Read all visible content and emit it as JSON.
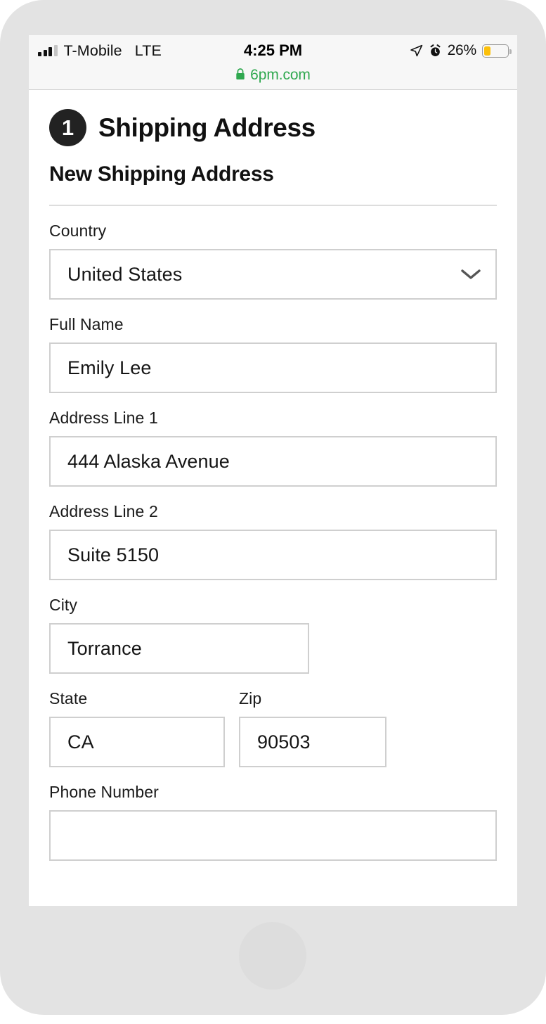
{
  "status_bar": {
    "carrier": "T-Mobile",
    "network": "LTE",
    "time": "4:25 PM",
    "battery_percent": "26%",
    "signal_icon": "signal-bars-icon",
    "location_icon": "location-arrow-icon",
    "alarm_icon": "alarm-clock-icon",
    "battery_icon": "battery-icon",
    "battery_fill_color": "#fcc00a"
  },
  "browser": {
    "lock_icon": "lock-icon",
    "domain": "6pm.com",
    "domain_color": "#2fa84f"
  },
  "checkout": {
    "step_number": "1",
    "section_title": "Shipping Address",
    "subsection_title": "New Shipping Address",
    "fields": {
      "country": {
        "label": "Country",
        "value": "United States",
        "chevron_icon": "chevron-down-icon"
      },
      "full_name": {
        "label": "Full Name",
        "value": "Emily Lee"
      },
      "address_line_1": {
        "label": "Address Line 1",
        "value": "444 Alaska Avenue"
      },
      "address_line_2": {
        "label": "Address Line 2",
        "value": "Suite 5150"
      },
      "city": {
        "label": "City",
        "value": "Torrance"
      },
      "state": {
        "label": "State",
        "value": "CA"
      },
      "zip": {
        "label": "Zip",
        "value": "90503"
      },
      "phone_number": {
        "label": "Phone Number",
        "value": ""
      }
    }
  }
}
